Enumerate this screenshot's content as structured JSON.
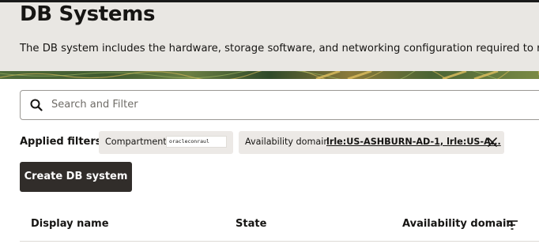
{
  "page": {
    "title": "DB Systems",
    "description": "The DB system includes the hardware, storage software, and networking configuration required to run Ora"
  },
  "search": {
    "placeholder": "Search and Filter",
    "icon": "search-icon"
  },
  "filters": {
    "label": "Applied filters",
    "compartment": {
      "label": "Compartment",
      "value": "oracleconraul"
    },
    "availability_domain": {
      "label": "Availability domain",
      "value": "lrle:US-ASHBURN-AD-1, lrle:US-A...",
      "close_icon": "close-icon"
    }
  },
  "actions": {
    "create_label": "Create DB system"
  },
  "table": {
    "columns": [
      {
        "label": "Display name"
      },
      {
        "label": "State"
      },
      {
        "label": "Availability domain"
      }
    ],
    "filter_icon": "filter-icon"
  },
  "colors": {
    "header_bg": "#e9e7e3",
    "primary_button": "#312d2a",
    "chip_bg": "#ece9e6",
    "text": "#161513"
  }
}
